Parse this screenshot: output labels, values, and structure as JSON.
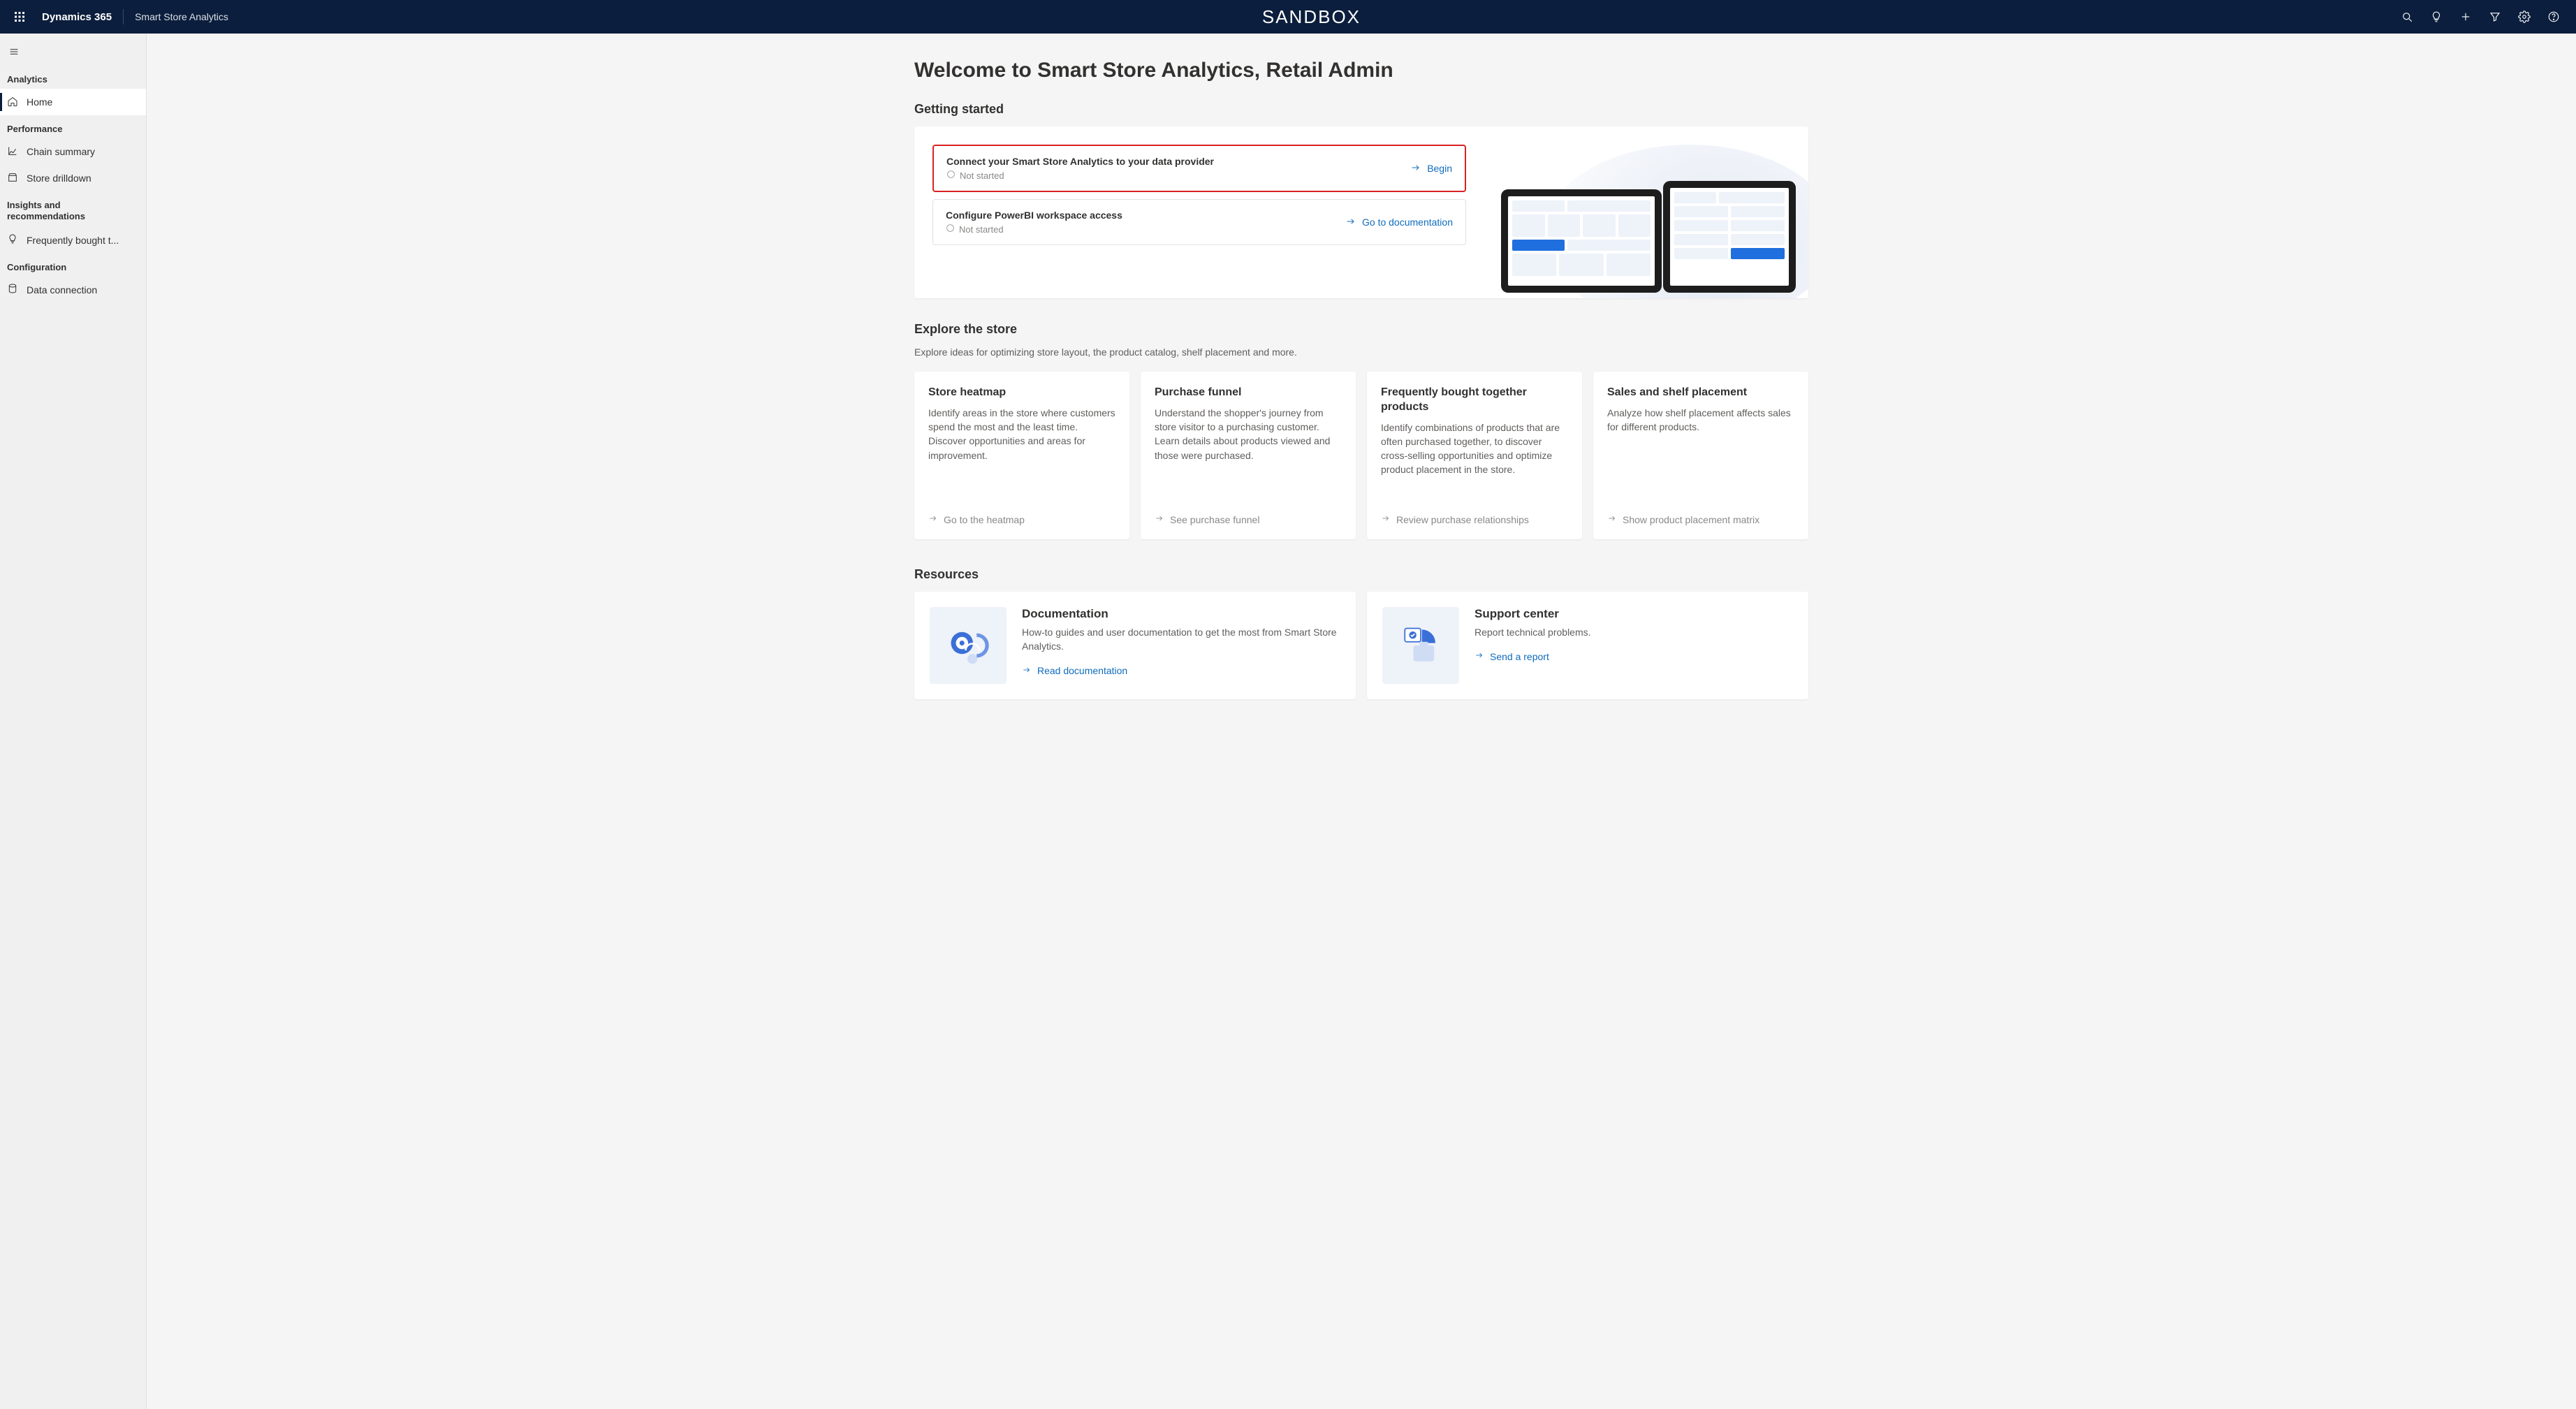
{
  "topbar": {
    "brand": "Dynamics 365",
    "app": "Smart Store Analytics",
    "environment": "SANDBOX"
  },
  "sidebar": {
    "sections": {
      "analytics": "Analytics",
      "performance": "Performance",
      "insights": "Insights and recommendations",
      "configuration": "Configuration"
    },
    "items": {
      "home": "Home",
      "chain_summary": "Chain summary",
      "store_drilldown": "Store drilldown",
      "frequently_bought": "Frequently bought t...",
      "data_connection": "Data connection"
    }
  },
  "page_title": "Welcome to Smart Store Analytics, Retail Admin",
  "getting_started": {
    "heading": "Getting started",
    "steps": [
      {
        "title": "Connect your Smart Store Analytics to your data provider",
        "status": "Not started",
        "action": "Begin"
      },
      {
        "title": "Configure PowerBI workspace access",
        "status": "Not started",
        "action": "Go to documentation"
      }
    ]
  },
  "explore": {
    "heading": "Explore the store",
    "description": "Explore ideas for optimizing store layout, the product catalog, shelf placement and more.",
    "cards": [
      {
        "title": "Store heatmap",
        "desc": "Identify areas in the store where customers spend the most and the least time. Discover opportunities and areas for improvement.",
        "link": "Go to the heatmap"
      },
      {
        "title": "Purchase funnel",
        "desc": "Understand the shopper's journey from store visitor to a purchasing customer. Learn details about products viewed and those were purchased.",
        "link": "See purchase funnel"
      },
      {
        "title": "Frequently bought together products",
        "desc": "Identify combinations of products that are often purchased together, to discover cross-selling opportunities and optimize product placement in the store.",
        "link": "Review purchase relationships"
      },
      {
        "title": "Sales and shelf placement",
        "desc": "Analyze how shelf placement affects sales for different products.",
        "link": "Show product placement matrix"
      }
    ]
  },
  "resources": {
    "heading": "Resources",
    "cards": [
      {
        "title": "Documentation",
        "desc": "How-to guides and user documentation to get the most from Smart Store Analytics.",
        "link": "Read documentation"
      },
      {
        "title": "Support center",
        "desc": "Report technical problems.",
        "link": "Send a report"
      }
    ]
  }
}
